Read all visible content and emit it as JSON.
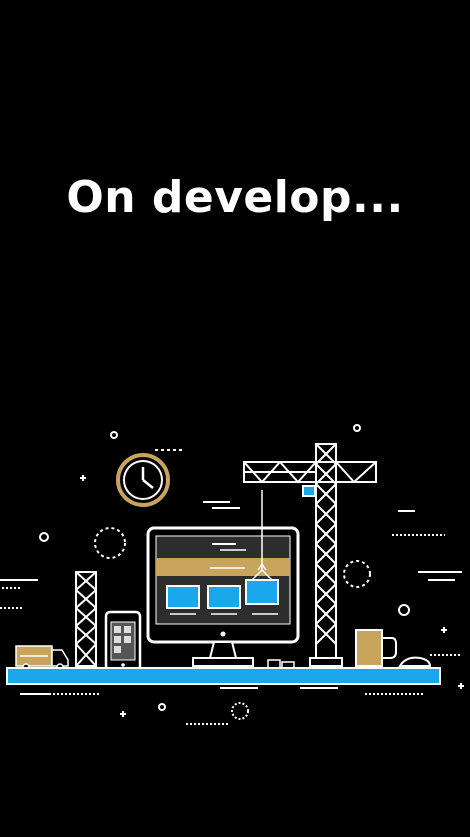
{
  "screen": {
    "headline": "On develop..."
  },
  "illustration": {
    "icon": "under-construction-website-illustration",
    "colors": {
      "background": "#000000",
      "line": "#ffffff",
      "accent_gold": "#c9a45c",
      "accent_blue": "#1aa7ec"
    }
  }
}
